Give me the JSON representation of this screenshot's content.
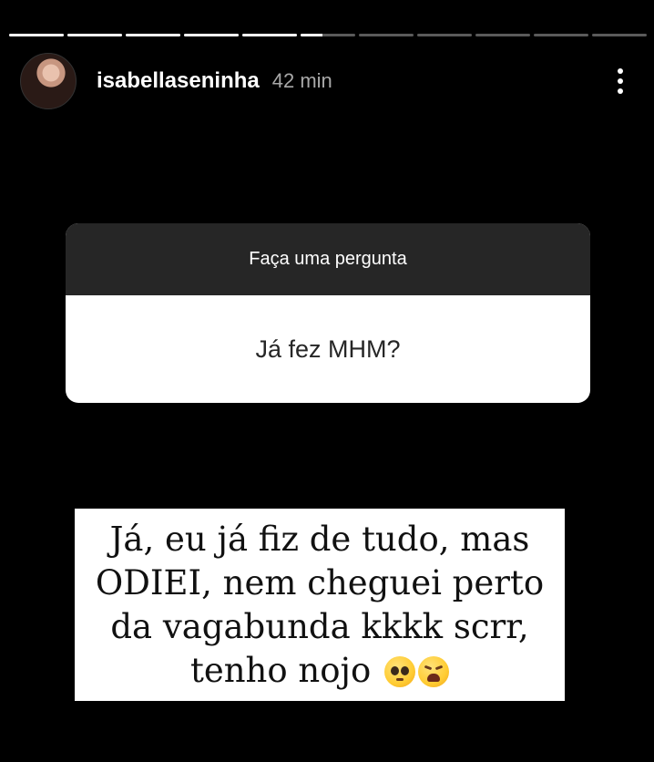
{
  "story": {
    "progress_segments": [
      1,
      1,
      1,
      1,
      1,
      0.4,
      0,
      0,
      0,
      0,
      0
    ],
    "progress_fill_color": "#ffffff",
    "progress_track_color": "#5a5a5a"
  },
  "header": {
    "username": "isabellaseninha",
    "time": "42 min",
    "more_icon": "more-vertical-icon"
  },
  "question_sticker": {
    "title": "Faça uma pergunta",
    "question": "Já fez MHM?"
  },
  "answer": {
    "text": "Já, eu já fiz de tudo, mas ODIEI, nem cheguei perto da vagabunda kkkk scrr, tenho nojo",
    "emojis": [
      "pleading-face-emoji",
      "weary-face-emoji"
    ]
  }
}
